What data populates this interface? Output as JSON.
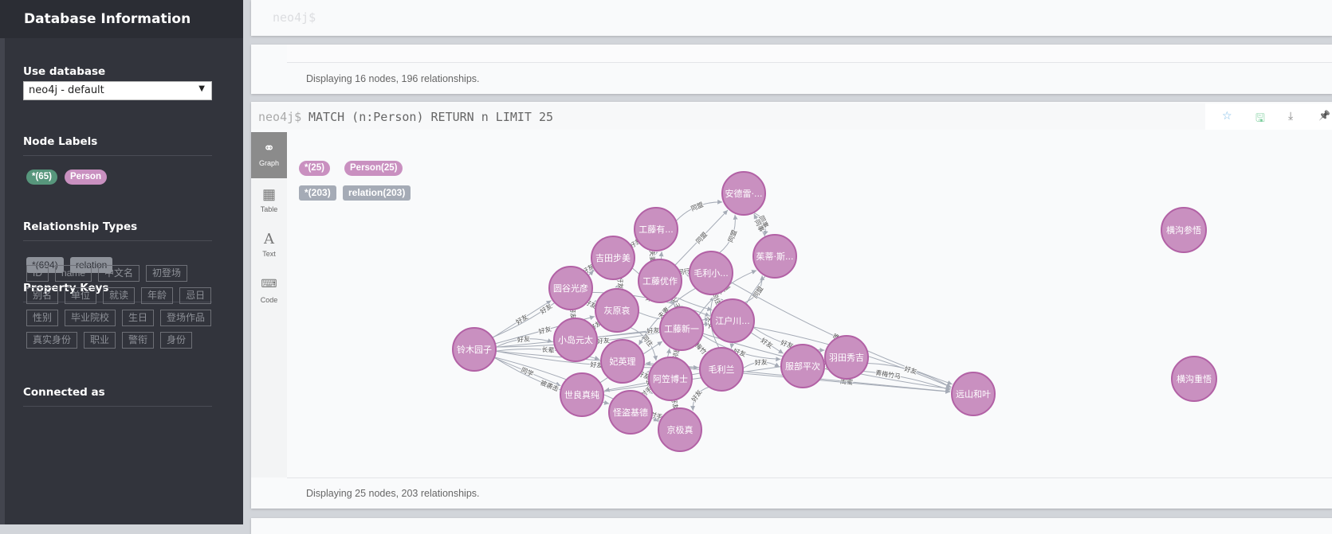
{
  "sidebar": {
    "title": "Database Information",
    "use_database": {
      "heading": "Use database",
      "selected": "neo4j - default"
    },
    "node_labels": {
      "heading": "Node Labels",
      "items": [
        {
          "label": "*(65)",
          "color": "#57967c"
        },
        {
          "label": "Person",
          "color": "#c990c0"
        }
      ]
    },
    "relationship_types": {
      "heading": "Relationship Types",
      "items": [
        "*(694)",
        "relation"
      ]
    },
    "property_keys": {
      "heading": "Property Keys",
      "items": [
        "ID",
        "name",
        "中文名",
        "初登场",
        "别名",
        "单位",
        "就读",
        "年龄",
        "忌日",
        "性别",
        "毕业院校",
        "生日",
        "登场作品",
        "真实身份",
        "职业",
        "警衔",
        "身份"
      ]
    },
    "connected_as": {
      "heading": "Connected as"
    }
  },
  "frame1": {
    "prompt": "neo4j$"
  },
  "frame2": {
    "status": "Displaying 16 nodes, 196 relationships."
  },
  "frame3": {
    "prompt": "neo4j$",
    "query": "MATCH (n:Person) RETURN n LIMIT 25",
    "tools": [
      {
        "name": "favorite-star-icon",
        "glyph": "☆",
        "color": "#7bbbe8"
      },
      {
        "name": "save-icon",
        "glyph": "🖫",
        "color": "#7fcf9f"
      },
      {
        "name": "download-icon",
        "glyph": "⤓",
        "color": "#888"
      },
      {
        "name": "pin-icon",
        "glyph": "📌",
        "color": "#999"
      }
    ],
    "view_tabs": [
      {
        "label": "Graph",
        "icon": "graph-icon",
        "active": true
      },
      {
        "label": "Table",
        "icon": "table-icon"
      },
      {
        "label": "Text",
        "icon": "text-icon"
      },
      {
        "label": "Code",
        "icon": "code-icon"
      }
    ],
    "legend_nodes": [
      "*(25)",
      "Person(25)"
    ],
    "legend_rels": [
      "*(203)",
      "relation(203)"
    ],
    "status": "Displaying 25 nodes, 203 relationships.",
    "node_color": "#c990c0",
    "node_border": "#b261a5",
    "edge_color": "#a5abb6"
  },
  "graph": {
    "nodes": [
      "安德雷·...",
      "工藤有...",
      "吉田步美",
      "毛利小...",
      "茱蒂·斯...",
      "工藤优作",
      "圆谷光彦",
      "灰原哀",
      "江户川...",
      "工藤新一",
      "铃木园子",
      "小岛元太",
      "妃英理",
      "毛利兰",
      "阿笠博士",
      "服部平次",
      "世良真纯",
      "怪盗基德",
      "京极真",
      "羽田秀吉",
      "远山和叶",
      "横沟参悟",
      "横沟重悟"
    ],
    "edges": [
      [
        1,
        0,
        "同盟"
      ],
      [
        5,
        0,
        "同盟"
      ],
      [
        3,
        0,
        "同盟"
      ],
      [
        0,
        4,
        "同事"
      ],
      [
        4,
        0,
        "同事"
      ],
      [
        8,
        4,
        "同盟"
      ],
      [
        9,
        4,
        "同盟"
      ],
      [
        10,
        6,
        "好友"
      ],
      [
        10,
        2,
        "好友"
      ],
      [
        10,
        11,
        "好友"
      ],
      [
        10,
        7,
        "好友"
      ],
      [
        10,
        13,
        "好友"
      ],
      [
        10,
        12,
        "长辈"
      ],
      [
        10,
        16,
        "同学"
      ],
      [
        10,
        17,
        "被袭击"
      ],
      [
        10,
        18,
        "恋人"
      ],
      [
        10,
        9,
        "好友"
      ],
      [
        10,
        8,
        "好友"
      ],
      [
        6,
        2,
        "好友"
      ],
      [
        6,
        11,
        "好友"
      ],
      [
        6,
        7,
        "好友"
      ],
      [
        2,
        7,
        "好友"
      ],
      [
        11,
        7,
        "好友"
      ],
      [
        2,
        8,
        "好友"
      ],
      [
        6,
        8,
        "好友"
      ],
      [
        11,
        8,
        "好友"
      ],
      [
        7,
        8,
        "好友"
      ],
      [
        7,
        14,
        "同住"
      ],
      [
        9,
        13,
        "青梅竹马"
      ],
      [
        9,
        5,
        "父子"
      ],
      [
        9,
        1,
        "母子"
      ],
      [
        9,
        14,
        "邻居"
      ],
      [
        9,
        15,
        "好友"
      ],
      [
        13,
        3,
        "父女"
      ],
      [
        13,
        12,
        "母女"
      ],
      [
        13,
        18,
        "好友"
      ],
      [
        13,
        15,
        "好友"
      ],
      [
        13,
        16,
        "好友"
      ],
      [
        3,
        12,
        "夫妻"
      ],
      [
        5,
        1,
        "夫妻"
      ],
      [
        8,
        15,
        "好友"
      ],
      [
        8,
        19,
        "好友"
      ],
      [
        15,
        20,
        "青梅竹马"
      ],
      [
        13,
        20,
        "闺蜜"
      ],
      [
        9,
        20,
        "好友"
      ],
      [
        8,
        20,
        "好友"
      ],
      [
        10,
        20,
        "长辈"
      ],
      [
        3,
        20,
        "晚辈"
      ],
      [
        19,
        20,
        "好友"
      ],
      [
        16,
        19,
        "兄妹"
      ],
      [
        17,
        9,
        "对手"
      ],
      [
        17,
        18,
        "对手"
      ],
      [
        14,
        18,
        "好友"
      ],
      [
        12,
        14,
        "好友"
      ],
      [
        5,
        3,
        "同行"
      ],
      [
        1,
        2,
        "好友"
      ],
      [
        4,
        13,
        "同盟"
      ],
      [
        17,
        14,
        "对手"
      ],
      [
        16,
        9,
        "好友"
      ],
      [
        3,
        8,
        "同住"
      ]
    ]
  }
}
